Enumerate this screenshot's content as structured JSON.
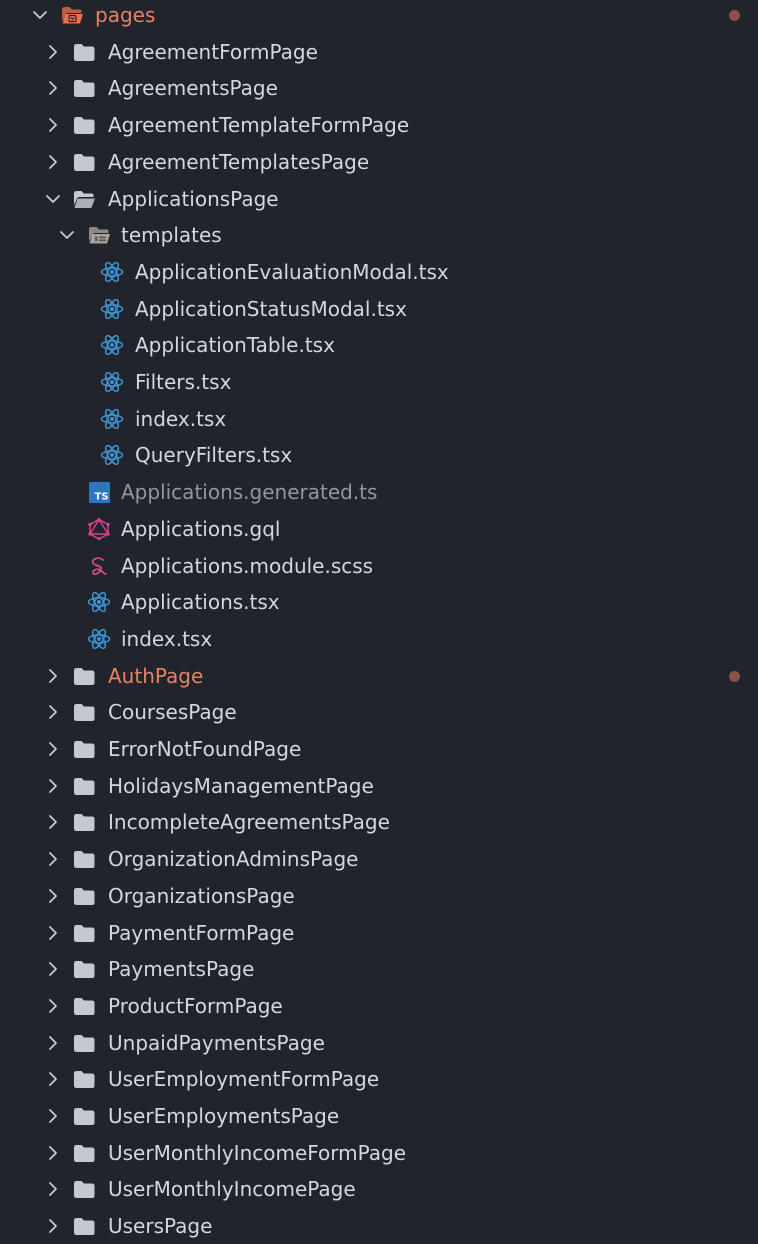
{
  "explorer": {
    "root": {
      "label": "pages",
      "expanded": true,
      "modified": true
    },
    "colors": {
      "background": "#21242b",
      "text": "#d4d7dd",
      "text_dim": "#9197a1",
      "modified_text": "#e8816a",
      "modified_dot": "#8a5248",
      "folder": "#c3c8d1",
      "root_folder": "#e8734f",
      "react": "#3f94d6",
      "typescript": "#2b77c4",
      "graphql": "#d93f8e",
      "sass": "#d24a88"
    },
    "items": [
      {
        "label": "AgreementFormPage",
        "type": "folder",
        "depth": 1,
        "expanded": false
      },
      {
        "label": "AgreementsPage",
        "type": "folder",
        "depth": 1,
        "expanded": false
      },
      {
        "label": "AgreementTemplateFormPage",
        "type": "folder",
        "depth": 1,
        "expanded": false
      },
      {
        "label": "AgreementTemplatesPage",
        "type": "folder",
        "depth": 1,
        "expanded": false
      },
      {
        "label": "ApplicationsPage",
        "type": "folder",
        "depth": 1,
        "expanded": true
      },
      {
        "label": "templates",
        "type": "templates-folder",
        "depth": 2,
        "expanded": true
      },
      {
        "label": "ApplicationEvaluationModal.tsx",
        "type": "react",
        "depth": 3
      },
      {
        "label": "ApplicationStatusModal.tsx",
        "type": "react",
        "depth": 3
      },
      {
        "label": "ApplicationTable.tsx",
        "type": "react",
        "depth": 3
      },
      {
        "label": "Filters.tsx",
        "type": "react",
        "depth": 3
      },
      {
        "label": "index.tsx",
        "type": "react",
        "depth": 3
      },
      {
        "label": "QueryFilters.tsx",
        "type": "react",
        "depth": 3
      },
      {
        "label": "Applications.generated.ts",
        "type": "typescript",
        "depth": 2,
        "dimmed": true
      },
      {
        "label": "Applications.gql",
        "type": "graphql",
        "depth": 2
      },
      {
        "label": "Applications.module.scss",
        "type": "sass",
        "depth": 2
      },
      {
        "label": "Applications.tsx",
        "type": "react",
        "depth": 2
      },
      {
        "label": "index.tsx",
        "type": "react",
        "depth": 2
      },
      {
        "label": "AuthPage",
        "type": "folder",
        "depth": 1,
        "expanded": false,
        "modified": true
      },
      {
        "label": "CoursesPage",
        "type": "folder",
        "depth": 1,
        "expanded": false
      },
      {
        "label": "ErrorNotFoundPage",
        "type": "folder",
        "depth": 1,
        "expanded": false
      },
      {
        "label": "HolidaysManagementPage",
        "type": "folder",
        "depth": 1,
        "expanded": false
      },
      {
        "label": "IncompleteAgreementsPage",
        "type": "folder",
        "depth": 1,
        "expanded": false
      },
      {
        "label": "OrganizationAdminsPage",
        "type": "folder",
        "depth": 1,
        "expanded": false
      },
      {
        "label": "OrganizationsPage",
        "type": "folder",
        "depth": 1,
        "expanded": false
      },
      {
        "label": "PaymentFormPage",
        "type": "folder",
        "depth": 1,
        "expanded": false
      },
      {
        "label": "PaymentsPage",
        "type": "folder",
        "depth": 1,
        "expanded": false
      },
      {
        "label": "ProductFormPage",
        "type": "folder",
        "depth": 1,
        "expanded": false
      },
      {
        "label": "UnpaidPaymentsPage",
        "type": "folder",
        "depth": 1,
        "expanded": false
      },
      {
        "label": "UserEmploymentFormPage",
        "type": "folder",
        "depth": 1,
        "expanded": false
      },
      {
        "label": "UserEmploymentsPage",
        "type": "folder",
        "depth": 1,
        "expanded": false
      },
      {
        "label": "UserMonthlyIncomeFormPage",
        "type": "folder",
        "depth": 1,
        "expanded": false
      },
      {
        "label": "UserMonthlyIncomePage",
        "type": "folder",
        "depth": 1,
        "expanded": false
      },
      {
        "label": "UsersPage",
        "type": "folder",
        "depth": 1,
        "expanded": false
      }
    ]
  }
}
